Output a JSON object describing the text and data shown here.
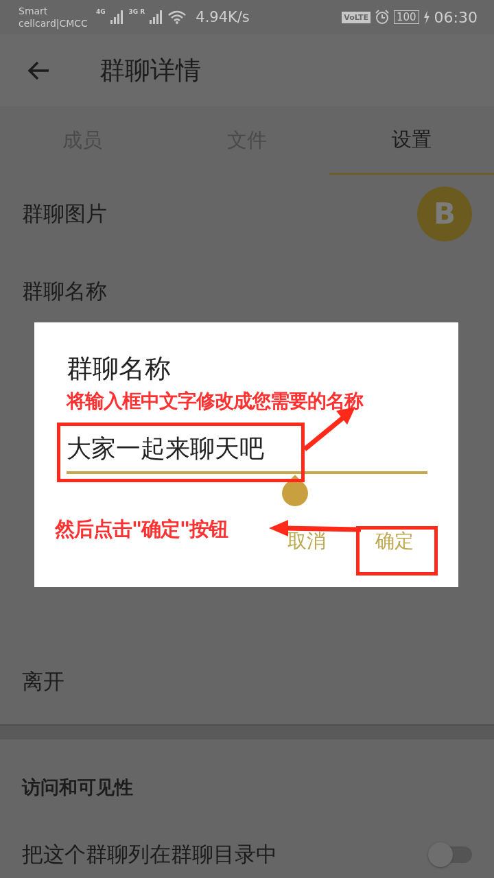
{
  "status_bar": {
    "carrier_top": "Smart",
    "carrier_bottom": "cellcard|CMCC",
    "signal_1_label": "4G",
    "signal_2_label": "3G R",
    "net_speed": "4.94K/s",
    "volte": "VoLTE",
    "battery": "100",
    "time": "06:30"
  },
  "header": {
    "title": "群聊详情"
  },
  "tabs": [
    {
      "label": "成员",
      "selected": false
    },
    {
      "label": "文件",
      "selected": false
    },
    {
      "label": "设置",
      "selected": true
    }
  ],
  "settings": {
    "rows": [
      {
        "label": "群聊图片",
        "kind": "avatar",
        "avatar": "B"
      },
      {
        "label": "群聊名称",
        "kind": "plain"
      }
    ],
    "leave": "离开"
  },
  "visibility": {
    "heading": "访问和可见性",
    "toggle": {
      "label": "把这个群聊列在群聊目录中",
      "on": false
    }
  },
  "dialog": {
    "title": "群聊名称",
    "input_value": "大家一起来聊天吧",
    "buttons": [
      {
        "label": "取消",
        "kind": "cancel"
      },
      {
        "label": "确定",
        "kind": "confirm"
      }
    ]
  },
  "annotations": [
    {
      "text": "将输入框中文字修改成您需要的名称"
    },
    {
      "text": "然后点击\"确定\"按钮"
    }
  ]
}
